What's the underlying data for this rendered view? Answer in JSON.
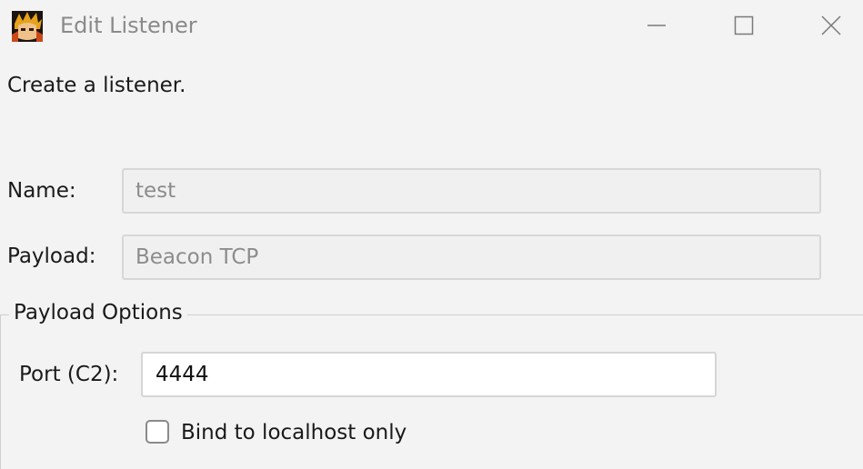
{
  "window": {
    "title": "Edit Listener",
    "icon": "app-character-icon",
    "controls": [
      "minimize-icon",
      "maximize-icon",
      "close-icon"
    ]
  },
  "form": {
    "intro": "Create a listener.",
    "name_label": "Name:",
    "name_value": "test",
    "payload_label": "Payload:",
    "payload_value": "Beacon TCP"
  },
  "payload_options": {
    "title": "Payload Options",
    "port_label": "Port (C2):",
    "port_value": "4444",
    "bind_localhost_label": "Bind to localhost only",
    "bind_localhost_checked": false
  },
  "colors": {
    "background": "#f3f3f3",
    "disabled_text": "#8c8c8c",
    "title_text": "#8a8a8a"
  }
}
